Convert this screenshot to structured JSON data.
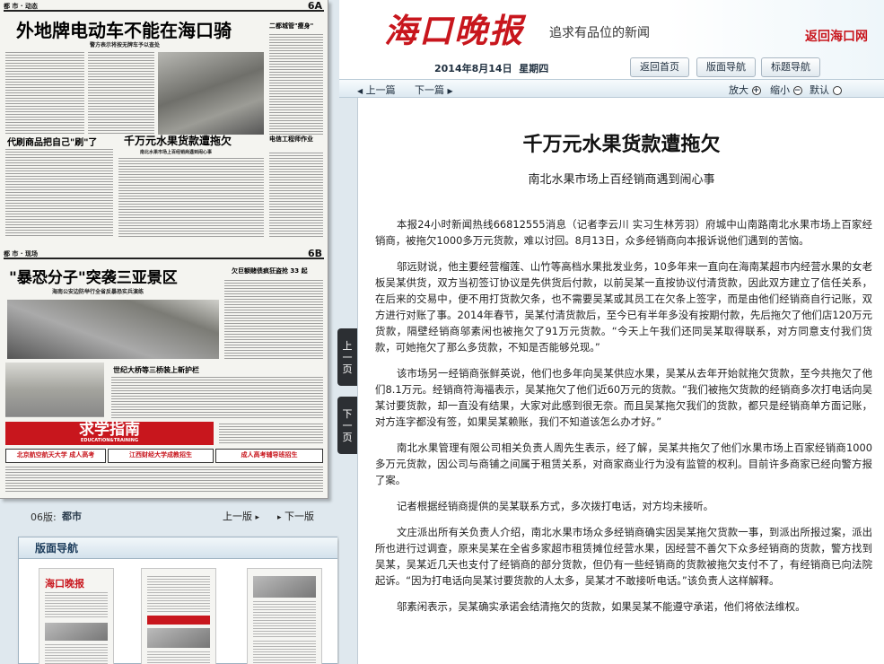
{
  "left_page": {
    "top_section_label": "都 市 · 动态",
    "top_page_code": "6A",
    "headline_1": "外地牌电动车不能在海口骑",
    "subhead_1": "警方表示将按无牌车予以查处",
    "side_headline_1": "二都城管\"瘦身\"",
    "mid_headline_left": "代刷商品把自己\"刷\"了",
    "mid_headline_right": "千万元水果货款遭拖欠",
    "mid_sub_right": "南北水果市场上百经销商遇到闹心事",
    "side_headline_2": "电信工程师作业",
    "bottom_section_label": "都 市 · 现场",
    "bottom_page_code": "6B",
    "headline_2": "\"暴恐分子\"突袭三亚景区",
    "subhead_2": "海南公安边防举行全省反暴恐实兵演练",
    "side_headline_3": "欠巨额赌债疯狂盗抢 33 起",
    "small_headline": "世纪大桥等三桥装上新护栏",
    "ad_banner_text": "求学指南",
    "ad_banner_sub": "EDUCATION&TRAINING",
    "ad_strip_1": "北京航空航天大学 成人高考",
    "ad_strip_2": "江西财经大学成教招生",
    "ad_strip_3": "成人高考辅导班招生"
  },
  "page_nav": {
    "prefix": "06版:",
    "name": "都市",
    "prev": "上一版",
    "next": "下一版"
  },
  "layout_nav": {
    "title": "版面导航",
    "thumb_masthead": "海口晚报"
  },
  "header": {
    "masthead": "海口晚报",
    "slogan": "追求有品位的新闻",
    "return_site": "返回海口网",
    "date": "2014年8月14日",
    "weekday": "星期四",
    "buttons": [
      "返回首页",
      "版面导航",
      "标题导航"
    ]
  },
  "toolbar": {
    "prev_article": "上一篇",
    "next_article": "下一篇",
    "zoom_in": "放大",
    "zoom_out": "缩小",
    "zoom_default": "默认"
  },
  "side_tabs": {
    "prev_page": [
      "上",
      "一",
      "页"
    ],
    "next_page": [
      "下",
      "一",
      "页"
    ]
  },
  "article": {
    "title": "千万元水果货款遭拖欠",
    "subtitle": "南北水果市场上百经销商遇到闹心事",
    "paragraphs": [
      "本报24小时新闻热线66812555消息（记者李云川 实习生林芳羽）府城中山南路南北水果市场上百家经销商，被拖欠1000多万元货款，难以讨回。8月13日，众多经销商向本报诉说他们遇到的苦恼。",
      "邬远财说，他主要经营榴莲、山竹等高档水果批发业务，10多年来一直向在海南某超市内经营水果的女老板吴某供货，双方当初签订协议是先供货后付款，以前吴某一直按协议付清货款，因此双方建立了信任关系，在后来的交易中，便不用打货款欠条，也不需要吴某或其员工在欠条上签字，而是由他们经销商自行记账，双方进行对账了事。2014年春节，吴某付清货款后，至今已有半年多没有按期付款，先后拖欠了他们店120万元货款，隔壁经销商邬素闲也被拖欠了91万元货款。“今天上午我们还同吴某取得联系，对方同意支付我们货款，可她拖欠了那么多货款，不知是否能够兑现。”",
      "该市场另一经销商张鲜英说，他们也多年向吴某供应水果，吴某从去年开始就拖欠货款，至今共拖欠了他们8.1万元。经销商符海福表示，吴某拖欠了他们近60万元的货款。“我们被拖欠货款的经销商多次打电话向吴某讨要货款，却一直没有结果，大家对此感到很无奈。而且吴某拖欠我们的货款，都只是经销商单方面记账，对方连字都没有签，如果吴某赖账，我们不知道该怎么办才好。”",
      "南北水果管理有限公司相关负责人周先生表示，经了解，吴某共拖欠了他们水果市场上百家经销商1000多万元货款，因公司与商铺之间属于租赁关系，对商家商业行为没有监管的权利。目前许多商家已经向警方报了案。",
      "记者根据经销商提供的吴某联系方式，多次拨打电话，对方均未接听。",
      "文庄派出所有关负责人介绍，南北水果市场众多经销商确实因吴某拖欠货款一事，到派出所报过案，派出所也进行过调查，原来吴某在全省多家超市租赁摊位经营水果，因经营不善欠下众多经销商的货款，警方找到吴某，吴某近几天也支付了经销商的部分货款，但仍有一些经销商的货款被拖欠支付不了，有经销商已向法院起诉。“因为打电话向吴某讨要货款的人太多，吴某才不敢接听电话。”该负责人这样解释。",
      "邬素闲表示，吴某确实承诺会结清拖欠的货款，如果吴某不能遵守承诺，他们将依法维权。"
    ]
  },
  "colors": {
    "brand_red": "#c8161d",
    "panel_blue": "#dfe8ee",
    "tab_dark": "#2c2f33"
  }
}
